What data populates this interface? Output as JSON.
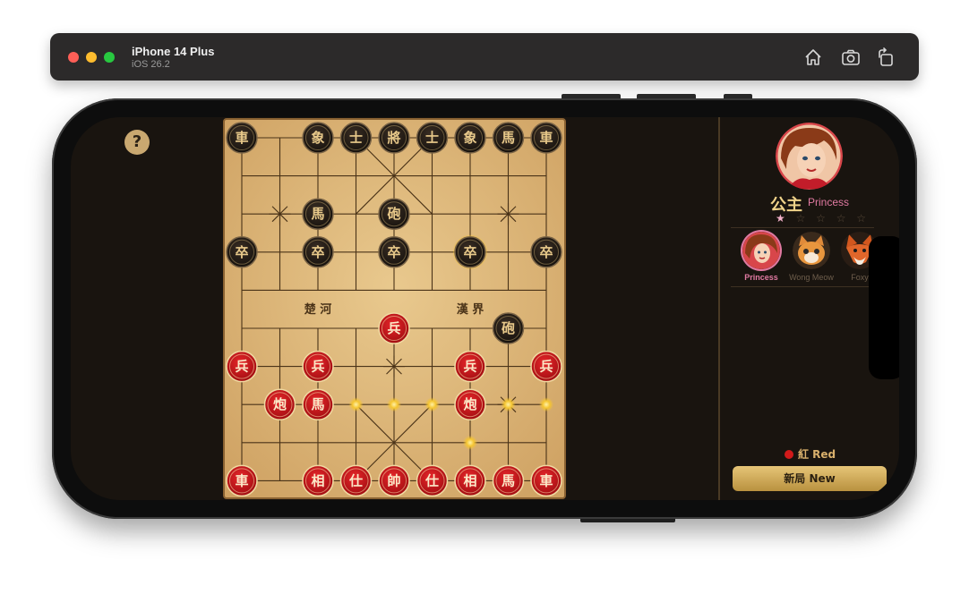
{
  "window": {
    "device_name": "iPhone 14 Plus",
    "os_version": "iOS 26.2",
    "toolbar": [
      {
        "icon": "home-icon"
      },
      {
        "icon": "screenshot-icon"
      },
      {
        "icon": "rotate-icon"
      }
    ]
  },
  "game": {
    "help_label": "?",
    "river_left": "楚 河",
    "river_right": "漢 界",
    "black_pieces": [
      {
        "ch": "車",
        "file": 0,
        "rank": 0
      },
      {
        "ch": "象",
        "file": 2,
        "rank": 0
      },
      {
        "ch": "士",
        "file": 3,
        "rank": 0
      },
      {
        "ch": "將",
        "file": 4,
        "rank": 0
      },
      {
        "ch": "士",
        "file": 5,
        "rank": 0
      },
      {
        "ch": "象",
        "file": 6,
        "rank": 0
      },
      {
        "ch": "馬",
        "file": 7,
        "rank": 0
      },
      {
        "ch": "車",
        "file": 8,
        "rank": 0
      },
      {
        "ch": "馬",
        "file": 2,
        "rank": 2
      },
      {
        "ch": "砲",
        "file": 4,
        "rank": 2
      },
      {
        "ch": "卒",
        "file": 0,
        "rank": 3
      },
      {
        "ch": "卒",
        "file": 2,
        "rank": 3
      },
      {
        "ch": "卒",
        "file": 4,
        "rank": 3
      },
      {
        "ch": "卒",
        "file": 6,
        "rank": 3,
        "highlight": true
      },
      {
        "ch": "卒",
        "file": 8,
        "rank": 3
      },
      {
        "ch": "砲",
        "file": 7,
        "rank": 5
      }
    ],
    "red_pieces": [
      {
        "ch": "兵",
        "file": 4,
        "rank": 5
      },
      {
        "ch": "兵",
        "file": 0,
        "rank": 6
      },
      {
        "ch": "兵",
        "file": 2,
        "rank": 6
      },
      {
        "ch": "兵",
        "file": 6,
        "rank": 6
      },
      {
        "ch": "兵",
        "file": 8,
        "rank": 6
      },
      {
        "ch": "炮",
        "file": 1,
        "rank": 7
      },
      {
        "ch": "馬",
        "file": 2,
        "rank": 7
      },
      {
        "ch": "炮",
        "file": 6,
        "rank": 7
      },
      {
        "ch": "車",
        "file": 0,
        "rank": 9
      },
      {
        "ch": "相",
        "file": 2,
        "rank": 9
      },
      {
        "ch": "仕",
        "file": 3,
        "rank": 9
      },
      {
        "ch": "帥",
        "file": 4,
        "rank": 9
      },
      {
        "ch": "仕",
        "file": 5,
        "rank": 9
      },
      {
        "ch": "相",
        "file": 6,
        "rank": 9
      },
      {
        "ch": "馬",
        "file": 7,
        "rank": 9
      },
      {
        "ch": "車",
        "file": 8,
        "rank": 9
      }
    ],
    "move_hints": [
      {
        "file": 3,
        "rank": 7
      },
      {
        "file": 4,
        "rank": 7
      },
      {
        "file": 5,
        "rank": 7
      },
      {
        "file": 7,
        "rank": 7
      },
      {
        "file": 8,
        "rank": 7
      },
      {
        "file": 6,
        "rank": 8
      }
    ],
    "colors": {
      "board_light": "#e6c488",
      "board_dark": "#c99a5a",
      "line": "#4a3318",
      "red_piece": "#c8141a",
      "black_piece": "#2a2018",
      "piece_text": "#e8c98a",
      "hint": "#f5c531"
    }
  },
  "sidebar": {
    "character_cn": "公主",
    "character_en": "Princess",
    "stars": {
      "on": "★",
      "off": "☆ ☆ ☆ ☆"
    },
    "opponents": [
      {
        "name": "Princess",
        "selected": true
      },
      {
        "name": "Wong Meow",
        "selected": false
      },
      {
        "name": "Foxy",
        "selected": false
      }
    ],
    "turn_label": "紅 Red",
    "new_game_label": "新局  New"
  }
}
